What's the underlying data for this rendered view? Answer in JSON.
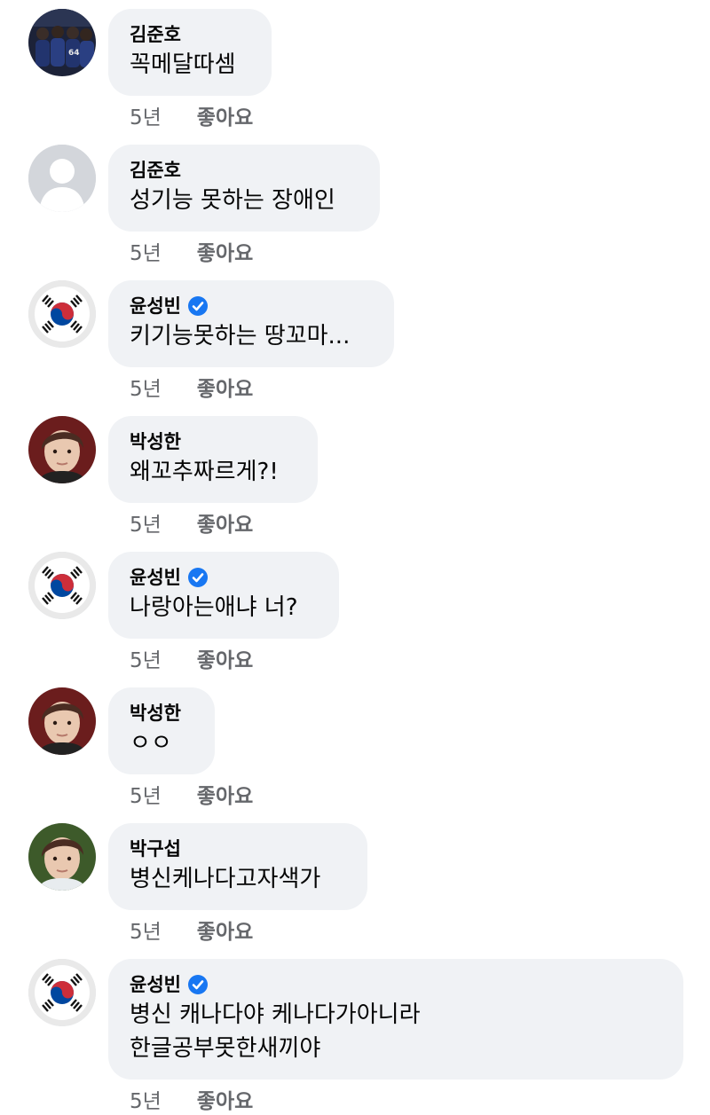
{
  "comments": [
    {
      "name": "김준호",
      "verified": false,
      "avatar": "team-photo-avatar",
      "lines": [
        "꼭메달따셈"
      ],
      "time": "5년",
      "like": "좋아요"
    },
    {
      "name": "김준호",
      "verified": false,
      "avatar": "default-silhouette-avatar",
      "lines": [
        "성기능 못하는 장애인"
      ],
      "time": "5년",
      "like": "좋아요"
    },
    {
      "name": "윤성빈",
      "verified": true,
      "avatar": "korean-flag-avatar",
      "lines": [
        "키기능못하는 땅꼬마..."
      ],
      "time": "5년",
      "like": "좋아요"
    },
    {
      "name": "박성한",
      "verified": false,
      "avatar": "user-photo-avatar",
      "lines": [
        "왜꼬추짜르게?!"
      ],
      "time": "5년",
      "like": "좋아요"
    },
    {
      "name": "윤성빈",
      "verified": true,
      "avatar": "korean-flag-avatar",
      "lines": [
        "나랑아는애냐 너?"
      ],
      "time": "5년",
      "like": "좋아요"
    },
    {
      "name": "박성한",
      "verified": false,
      "avatar": "user-photo-avatar",
      "lines": [
        "ㅇㅇ"
      ],
      "time": "5년",
      "like": "좋아요"
    },
    {
      "name": "박구섭",
      "verified": false,
      "avatar": "user-photo-avatar",
      "lines": [
        "병신케나다고자색가"
      ],
      "time": "5년",
      "like": "좋아요"
    },
    {
      "name": "윤성빈",
      "verified": true,
      "avatar": "korean-flag-avatar",
      "lines": [
        "병신 캐나다야 케나다가아니라",
        "한글공부못한새끼야"
      ],
      "time": "5년",
      "like": "좋아요"
    }
  ],
  "colors": {
    "bubble": "#f0f2f5",
    "meta_text": "#65676b",
    "verified_badge": "#1877f2",
    "flag_red": "#cd2e3a",
    "flag_blue": "#0047a0"
  }
}
